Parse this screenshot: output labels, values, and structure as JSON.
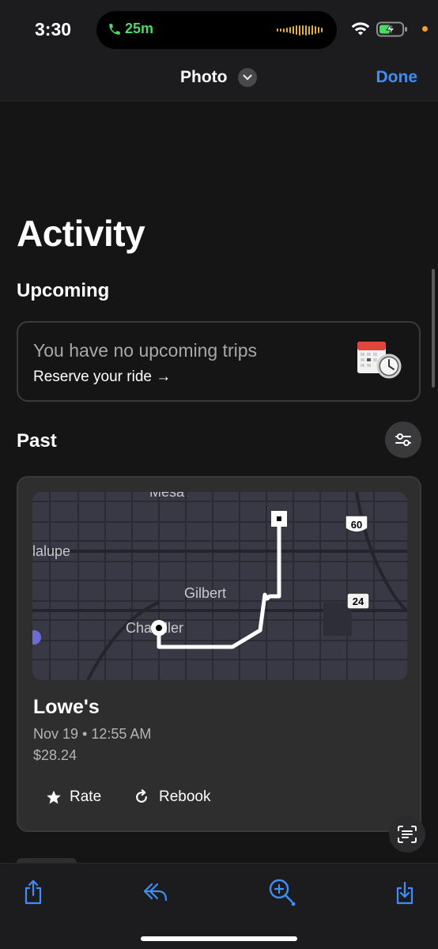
{
  "status_bar": {
    "time": "3:30",
    "call_duration": "25m",
    "icons": [
      "phone-icon",
      "waveform-icon",
      "wifi-icon",
      "battery-charging-icon"
    ]
  },
  "nav": {
    "title": "Photo",
    "done_label": "Done"
  },
  "activity": {
    "title": "Activity",
    "upcoming_heading": "Upcoming",
    "upcoming_empty_text": "You have no upcoming trips",
    "reserve_link": "Reserve your ride →",
    "past_heading": "Past"
  },
  "trip": {
    "destination": "Lowe's",
    "datetime": "Nov 19 • 12:55 AM",
    "price": "$28.24",
    "rate_label": "Rate",
    "rebook_label": "Rebook",
    "map_labels": {
      "mesa": "Mesa",
      "guadalupe": "lalupe",
      "gilbert": "Gilbert",
      "chandler": "Chandler",
      "route_60": "60",
      "route_24": "24"
    }
  },
  "colors": {
    "accent_blue": "#3d8ef7",
    "call_green": "#4cd964",
    "background": "#151515",
    "card": "#2e2e2e"
  }
}
